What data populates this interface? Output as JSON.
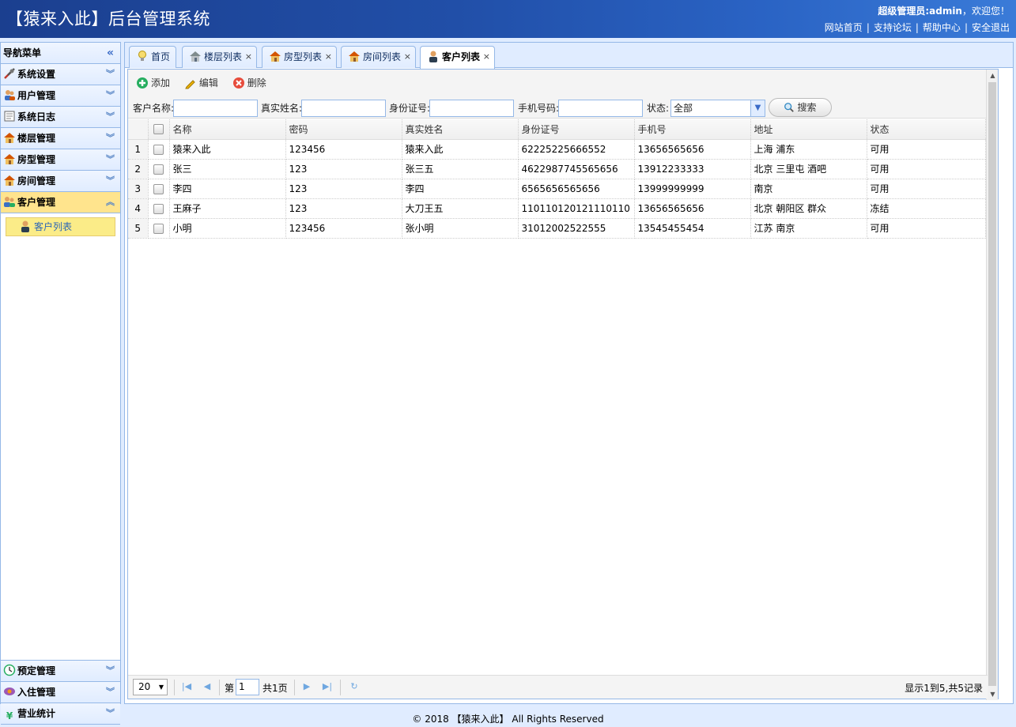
{
  "header": {
    "title": "【猿来入此】后台管理系统",
    "welcome_user": "超级管理员:admin",
    "welcome_suffix": "，欢迎您！",
    "links": [
      "网站首页",
      "支持论坛",
      "帮助中心",
      "安全退出"
    ]
  },
  "sidebar": {
    "title": "导航菜单",
    "top_groups": [
      {
        "label": "系统设置",
        "icon": "tools-icon"
      },
      {
        "label": "用户管理",
        "icon": "users-icon"
      },
      {
        "label": "系统日志",
        "icon": "log-icon"
      },
      {
        "label": "楼层管理",
        "icon": "building-icon"
      },
      {
        "label": "房型管理",
        "icon": "house-icon"
      },
      {
        "label": "房间管理",
        "icon": "house-icon"
      },
      {
        "label": "客户管理",
        "icon": "customers-icon"
      }
    ],
    "active_sub": "客户列表",
    "bottom_groups": [
      {
        "label": "预定管理",
        "icon": "clock-icon"
      },
      {
        "label": "入住管理",
        "icon": "checkin-icon"
      },
      {
        "label": "营业统计",
        "icon": "money-icon"
      }
    ]
  },
  "tabs": [
    {
      "label": "首页",
      "closable": false
    },
    {
      "label": "楼层列表",
      "closable": true
    },
    {
      "label": "房型列表",
      "closable": true
    },
    {
      "label": "房间列表",
      "closable": true
    },
    {
      "label": "客户列表",
      "closable": true,
      "selected": true
    }
  ],
  "toolbar": {
    "add": "添加",
    "edit": "编辑",
    "delete": "删除"
  },
  "search": {
    "name_label": "客户名称:",
    "realname_label": "真实姓名:",
    "idcard_label": "身份证号:",
    "mobile_label": "手机号码:",
    "status_label": "状态:",
    "status_value": "全部",
    "button": "搜索"
  },
  "grid": {
    "columns": [
      "名称",
      "密码",
      "真实姓名",
      "身份证号",
      "手机号",
      "地址",
      "状态"
    ],
    "rows": [
      [
        "1",
        "猿来入此",
        "123456",
        "猿来入此",
        "62225225666552",
        "13656565656",
        "上海 浦东",
        "可用"
      ],
      [
        "2",
        "张三",
        "123",
        "张三五",
        "4622987745565656",
        "13912233333",
        "北京 三里屯 酒吧",
        "可用"
      ],
      [
        "3",
        "李四",
        "123",
        "李四",
        "6565656565656",
        "13999999999",
        "南京",
        "可用"
      ],
      [
        "4",
        "王麻子",
        "123",
        "大刀王五",
        "110110120121110110",
        "13656565656",
        "北京 朝阳区 群众",
        "冻结"
      ],
      [
        "5",
        "小明",
        "123456",
        "张小明",
        "31012002522555",
        "13545455454",
        "江苏 南京",
        "可用"
      ]
    ]
  },
  "pager": {
    "page_size": "20",
    "page_prefix": "第",
    "page_number": "1",
    "page_total": "共1页",
    "info": "显示1到5,共5记录"
  },
  "footer": "© 2018 【猿来入此】 All Rights Reserved"
}
